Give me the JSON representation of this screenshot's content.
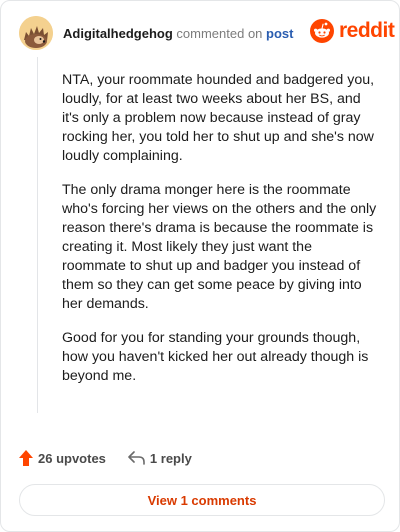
{
  "comment": {
    "username": "Adigitalhedgehog",
    "action_text": "commented on",
    "target_link": "post",
    "paragraphs": [
      "NTA, your roommate hounded and badgered you, loudly, for at least two weeks about her BS, and it's only a problem now because instead of gray rocking her, you told her to shut up and she's now loudly complaining.",
      "The only drama monger here is the roommate who's forcing her views on the others and the only reason there's drama is because the roommate is creating it. Most likely they just want the roommate to shut up and badger you instead of them so they can get some peace by giving into her demands.",
      "Good for you for standing your grounds though, how you haven't kicked her out already though is beyond me."
    ],
    "upvotes_label": "26 upvotes",
    "replies_label": "1 reply",
    "view_comments_label": "View 1 comments"
  },
  "brand": {
    "name": "reddit",
    "color": "#ff4500"
  },
  "icons": {
    "avatar": "hedgehog-avatar",
    "upvote": "upvote-arrow-icon",
    "reply": "reply-arrow-icon",
    "logo": "reddit-snoo-icon"
  }
}
